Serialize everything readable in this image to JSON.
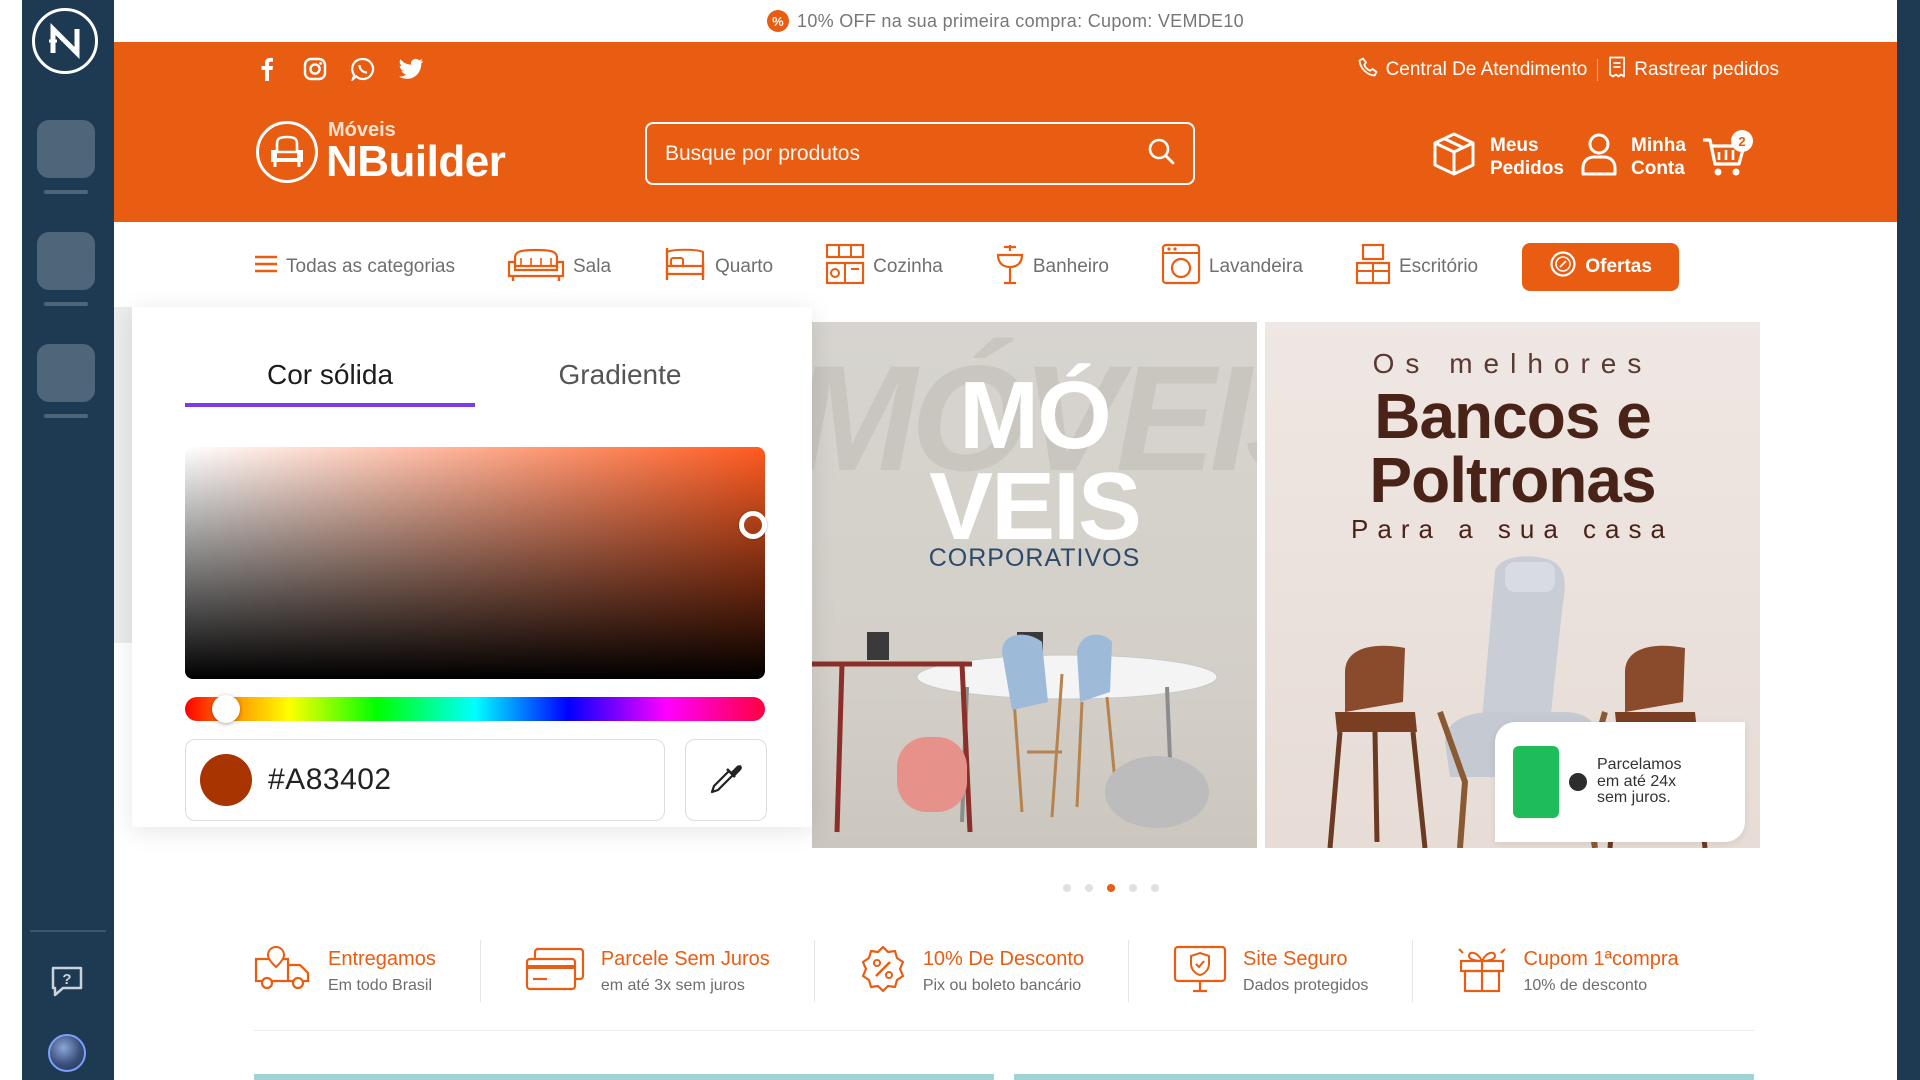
{
  "promo": {
    "text": "10% OFF na sua primeira compra: Cupom: VEMDE10"
  },
  "header": {
    "support_link": "Central De Atendimento",
    "track_link": "Rastrear pedidos",
    "brand_small": "Móveis",
    "brand_big": "NBuilder",
    "search_placeholder": "Busque por produtos",
    "orders": [
      "Meus",
      "Pedidos"
    ],
    "account": [
      "Minha",
      "Conta"
    ],
    "cart_count": "2"
  },
  "categories": {
    "all": "Todas as categorias",
    "items": [
      "Sala",
      "Quarto",
      "Cozinha",
      "Banheiro",
      "Lavandeira",
      "Escritório"
    ],
    "offers": "Ofertas"
  },
  "picker": {
    "tab_solid": "Cor sólida",
    "tab_gradient": "Gradiente",
    "hex": "#A83402",
    "color": "#A83402"
  },
  "banner1": {
    "title_line1": "MÓ",
    "title_line2": "VEIS",
    "subtitle": "CORPORATIVOS"
  },
  "banner2": {
    "kicker": "Os melhores",
    "title_line1": "Bancos e",
    "title_line2": "Poltronas",
    "subtitle": "Para a sua casa",
    "card_text": "Parcelamos em até 24x sem juros."
  },
  "carousel": {
    "count": 5,
    "active_index": 2
  },
  "benefits": [
    {
      "title": "Entregamos",
      "subtitle": "Em todo Brasil",
      "icon": "truck-icon"
    },
    {
      "title": "Parcele Sem Juros",
      "subtitle": "em até 3x sem juros",
      "icon": "credit-card-icon"
    },
    {
      "title": "10% De Desconto",
      "subtitle": "Pix ou boleto bancário",
      "icon": "percent-badge-icon"
    },
    {
      "title": "Site Seguro",
      "subtitle": "Dados protegidos",
      "icon": "shield-monitor-icon"
    },
    {
      "title": "Cupom 1ªcompra",
      "subtitle": "10% de desconto",
      "icon": "gift-icon"
    }
  ],
  "colors": {
    "brand": "#e85d11",
    "rail": "#1d3a52",
    "accent_tab": "#7c3aed"
  }
}
